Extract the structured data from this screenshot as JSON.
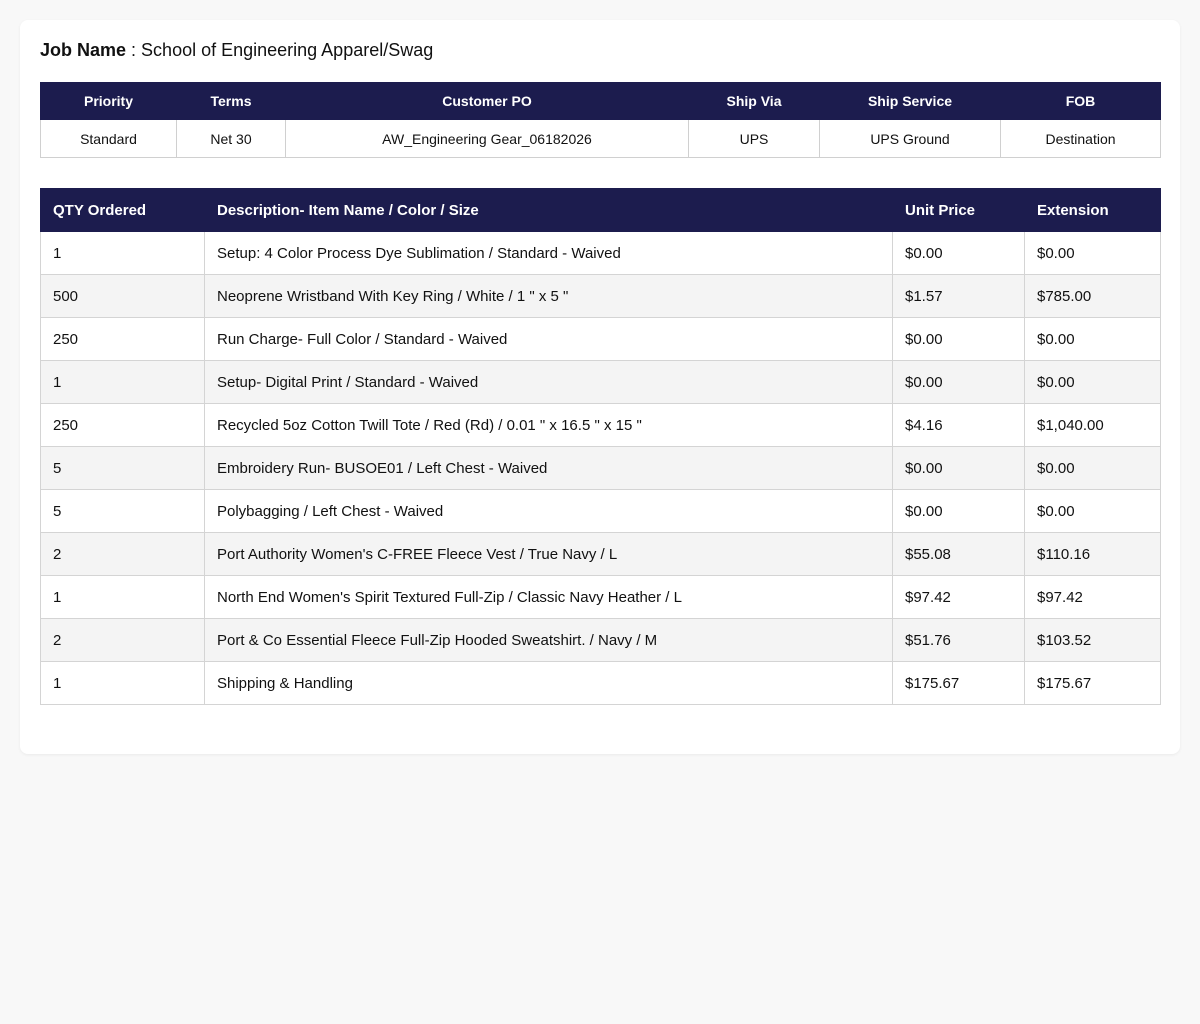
{
  "job": {
    "label": "Job Name",
    "separator": " : ",
    "value": "School of Engineering Apparel/Swag"
  },
  "info_table": {
    "headers": [
      "Priority",
      "Terms",
      "Customer PO",
      "Ship Via",
      "Ship Service",
      "FOB"
    ],
    "values": [
      "Standard",
      "Net 30",
      "AW_Engineering Gear_06182026",
      "UPS",
      "UPS Ground",
      "Destination"
    ]
  },
  "items_table": {
    "headers": [
      "QTY Ordered",
      "Description- Item Name / Color / Size",
      "Unit Price",
      "Extension"
    ],
    "rows": [
      [
        "1",
        "Setup: 4 Color Process Dye Sublimation / Standard - Waived",
        "$0.00",
        "$0.00"
      ],
      [
        "500",
        "Neoprene Wristband With Key Ring / White / 1 \" x 5 \"",
        "$1.57",
        "$785.00"
      ],
      [
        "250",
        "Run Charge- Full Color / Standard - Waived",
        "$0.00",
        "$0.00"
      ],
      [
        "1",
        "Setup- Digital Print / Standard - Waived",
        "$0.00",
        "$0.00"
      ],
      [
        "250",
        "Recycled 5oz Cotton Twill Tote / Red (Rd) / 0.01 \" x 16.5 \" x 15 \"",
        "$4.16",
        "$1,040.00"
      ],
      [
        "5",
        "Embroidery Run- BUSOE01 / Left Chest - Waived",
        "$0.00",
        "$0.00"
      ],
      [
        "5",
        "Polybagging / Left Chest - Waived",
        "$0.00",
        "$0.00"
      ],
      [
        "2",
        "Port Authority Women's C-FREE Fleece Vest / True Navy / L",
        "$55.08",
        "$110.16"
      ],
      [
        "1",
        "North End Women's Spirit Textured Full-Zip / Classic Navy Heather / L",
        "$97.42",
        "$97.42"
      ],
      [
        "2",
        "Port & Co Essential Fleece Full-Zip Hooded Sweatshirt. / Navy / M",
        "$51.76",
        "$103.52"
      ],
      [
        "1",
        "Shipping & Handling",
        "$175.67",
        "$175.67"
      ]
    ]
  },
  "colors": {
    "header_bg": "#1c1c4e",
    "header_text": "#ffffff",
    "row_alt_bg": "#f4f4f4",
    "page_bg": "#f8f8f8"
  }
}
